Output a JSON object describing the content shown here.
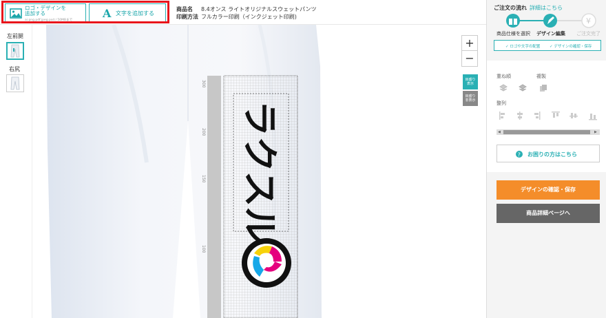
{
  "toolbar": {
    "logo_button_line1": "ロゴ・デザインを",
    "logo_button_line2": "追加する",
    "logo_button_formats": "ai.png.pdf.jpeg.psd / 50MBまで",
    "text_button_label": "文字を追加する"
  },
  "product": {
    "name_label": "商品名",
    "name_value": "8.4オンス ライトオリジナルスウェットパンツ",
    "method_label": "印刷方法",
    "method_value": "フルカラー印刷（インクジェット印刷)"
  },
  "views": {
    "left_thigh_label": "左前腿",
    "right_hip_label": "右尻"
  },
  "canvas": {
    "ruler_ticks": [
      "300",
      "200",
      "150",
      "100"
    ],
    "design_text": "ラクスル",
    "guide_show": [
      "目盛り",
      "表示"
    ],
    "guide_hide": [
      "目盛り",
      "非表示"
    ]
  },
  "flow": {
    "title": "ご注文の流れ",
    "details_link": "詳細はこちら",
    "step1": "商品仕様を選択",
    "step2": "デザイン編集",
    "step3": "ご注文完了",
    "check1": "ロゴや文字の配置",
    "check2": "デザインの確認・保存"
  },
  "tools": {
    "order_label": "重ね順",
    "copy_label": "複製",
    "align_label": "整列"
  },
  "help": {
    "label": "お困りの方はこちら"
  },
  "actions": {
    "confirm_save": "デザインの確認・保存",
    "product_page": "商品詳細ページへ"
  },
  "colors": {
    "accent": "#2ab0b4",
    "highlight_border": "#e8141b",
    "orange_button": "#f48d2a",
    "gray_button": "#666666"
  },
  "icons": {
    "image": "image-icon",
    "text": "letter-a-icon",
    "zoom_in": "plus-icon",
    "zoom_out": "minus-icon",
    "gift": "gift-icon",
    "pencil": "pencil-icon",
    "yen": "yen-icon",
    "help": "question-circle-icon"
  }
}
